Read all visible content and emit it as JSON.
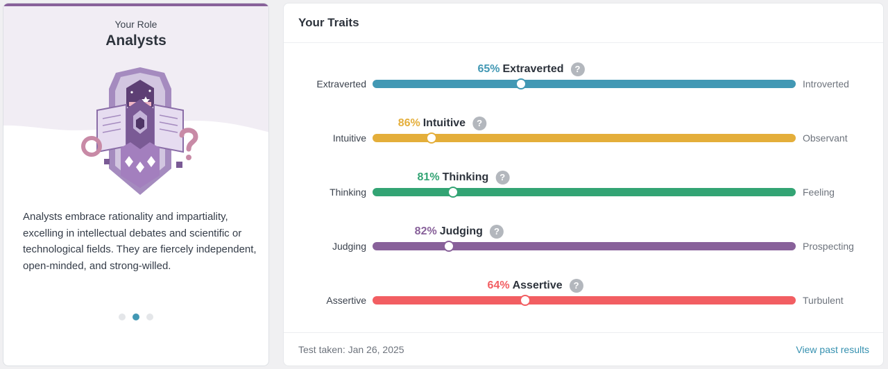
{
  "role": {
    "label": "Your Role",
    "name": "Analysts",
    "description": "Analysts embrace rationality and impartiality, excelling in intellectual debates and scientific or technological fields. They are fiercely independent, open-minded, and strong-willed.",
    "badge_icon": "analysts-shield-icon",
    "carousel": {
      "count": 3,
      "active_index": 1
    }
  },
  "traits": {
    "title": "Your Traits",
    "items": [
      {
        "percent": "65%",
        "name": "Extraverted",
        "left": "Extraverted",
        "right": "Introverted",
        "color": "#4298b4",
        "position": 0.35
      },
      {
        "percent": "86%",
        "name": "Intuitive",
        "left": "Intuitive",
        "right": "Observant",
        "color": "#e4ae3a",
        "position": 0.14
      },
      {
        "percent": "81%",
        "name": "Thinking",
        "left": "Thinking",
        "right": "Feeling",
        "color": "#33a474",
        "position": 0.19
      },
      {
        "percent": "82%",
        "name": "Judging",
        "left": "Judging",
        "right": "Prospecting",
        "color": "#88619a",
        "position": 0.18
      },
      {
        "percent": "64%",
        "name": "Assertive",
        "left": "Assertive",
        "right": "Turbulent",
        "color": "#f25e62",
        "position": 0.36
      }
    ],
    "help_icon": "question-mark-icon"
  },
  "footer": {
    "test_taken": "Test taken: Jan 26, 2025",
    "past_results_link": "View past results"
  }
}
